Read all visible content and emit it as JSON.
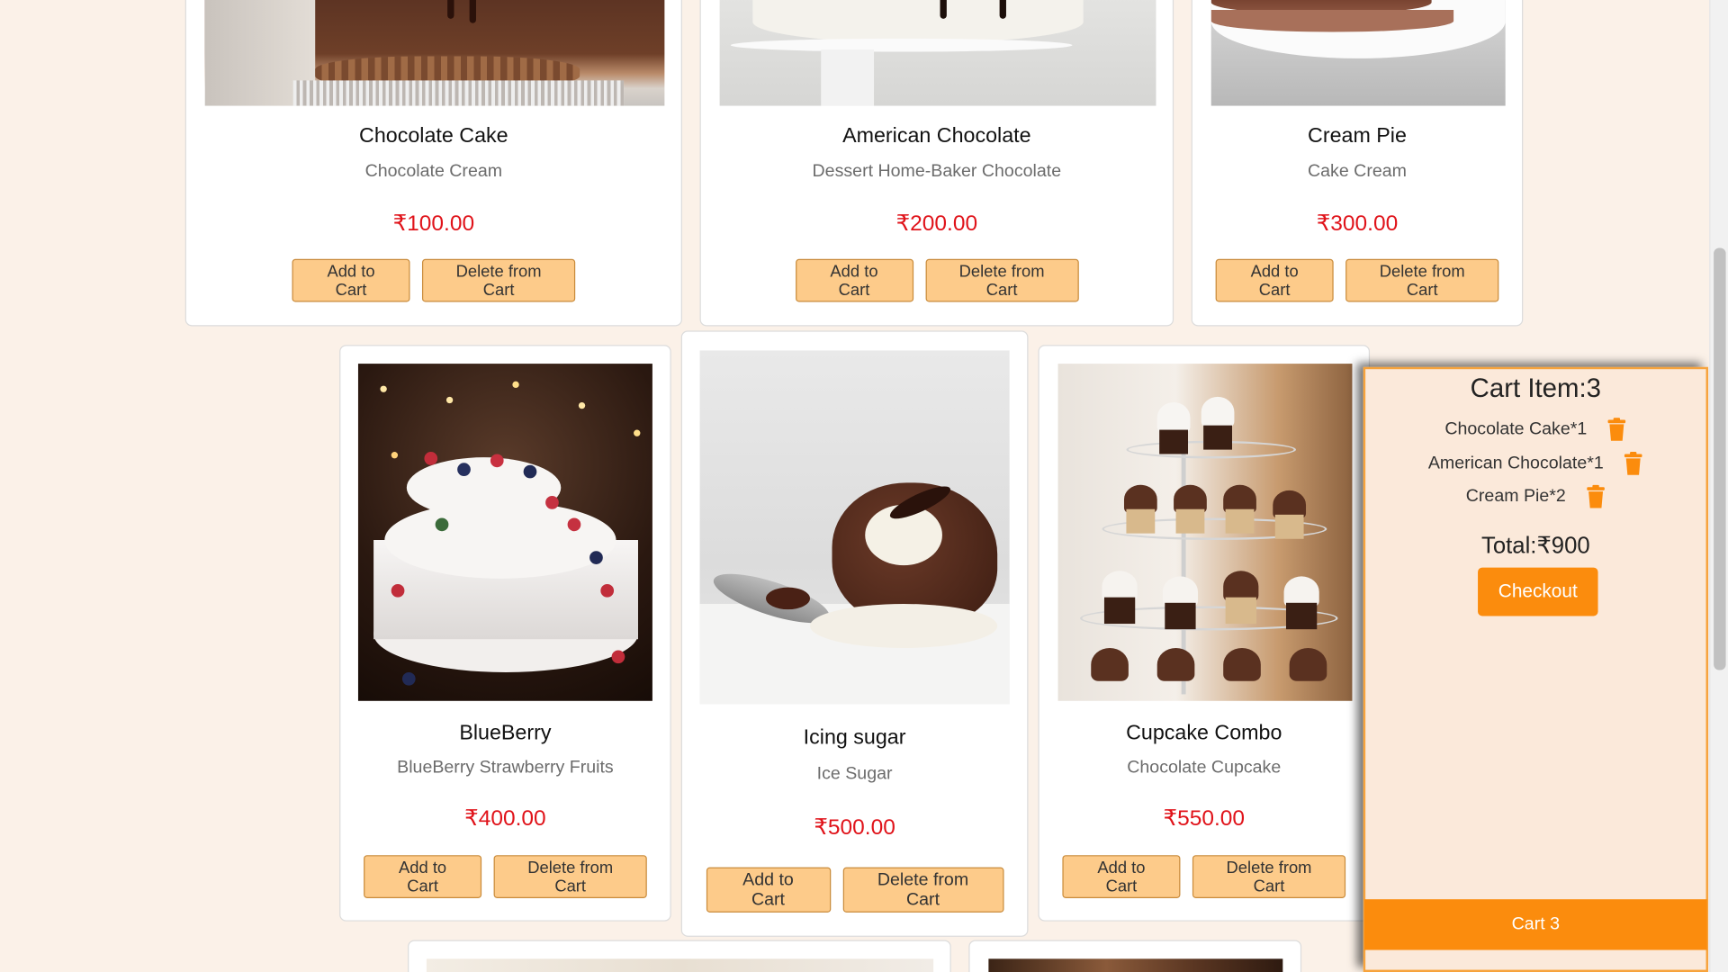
{
  "products": [
    {
      "name": "Chocolate Cake",
      "tags": "Chocolate Cream",
      "price": "₹100.00",
      "image": "chocolate-cake-photo"
    },
    {
      "name": "American Chocolate",
      "tags": "Dessert Home-Baker Chocolate",
      "price": "₹200.00",
      "image": "white-cake-stand-photo"
    },
    {
      "name": "Cream Pie",
      "tags": "Cake Cream",
      "price": "₹300.00",
      "image": "cream-pie-photo"
    },
    {
      "name": "BlueBerry",
      "tags": "BlueBerry Strawberry Fruits",
      "price": "₹400.00",
      "image": "berry-tier-cake-photo"
    },
    {
      "name": "Icing sugar",
      "tags": "Ice Sugar",
      "price": "₹500.00",
      "image": "lava-cake-photo"
    },
    {
      "name": "Cupcake Combo",
      "tags": "Chocolate Cupcake",
      "price": "₹550.00",
      "image": "cupcake-tower-photo"
    }
  ],
  "buttons": {
    "add": "Add to Cart",
    "delete": "Delete from Cart"
  },
  "cart": {
    "title": "Cart Item:3",
    "items": [
      {
        "label": "Chocolate Cake*1"
      },
      {
        "label": "American Chocolate*1"
      },
      {
        "label": "Cream Pie*2"
      }
    ],
    "total": "Total:₹900",
    "checkout": "Checkout",
    "bar_label": "Cart 3"
  },
  "colors": {
    "background": "#fbf1e8",
    "button": "#fdcb8a",
    "price": "#e0131a",
    "accent": "#fb8c0d"
  },
  "icons": {
    "trash": "trash-icon"
  }
}
